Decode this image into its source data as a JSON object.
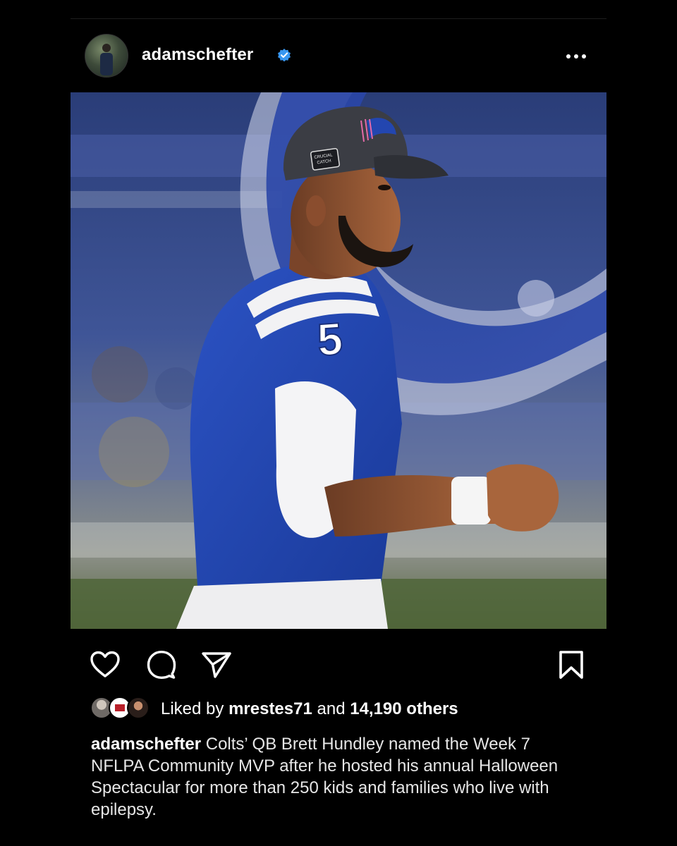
{
  "post": {
    "username": "adamschefter",
    "verified": true,
    "more_icon": "more-horizontal-icon",
    "photo_alt": "Colts quarterback wearing number 5",
    "jersey_number": "5",
    "cap_label": "CRUCIAL CATCH"
  },
  "actions": {
    "like_icon": "heart-icon",
    "comment_icon": "comment-icon",
    "share_icon": "send-icon",
    "save_icon": "bookmark-icon"
  },
  "likes": {
    "prefix": "Liked by",
    "user": "mrestes71",
    "conjunction": "and",
    "count": "14,190 others"
  },
  "caption": {
    "username": "adamschefter",
    "text": "Colts’ QB Brett Hundley named the Week 7 NFLPA Community MVP after he hosted his annual Halloween Spectacular for more than 250 kids and families who live with epilepsy."
  },
  "colors": {
    "background": "#000000",
    "verified_blue": "#3897f0",
    "colts_blue": "#1f44b0"
  }
}
